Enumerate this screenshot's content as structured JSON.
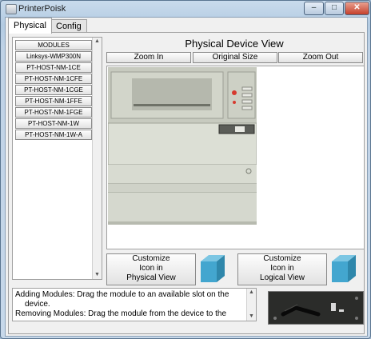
{
  "window": {
    "title": "PrinterPoisk"
  },
  "tabs": [
    {
      "label": "Physical",
      "active": true
    },
    {
      "label": "Config",
      "active": false
    }
  ],
  "modules": {
    "header": "MODULES",
    "items": [
      "Linksys-WMP300N",
      "PT-HOST-NM-1CE",
      "PT-HOST-NM-1CFE",
      "PT-HOST-NM-1CGE",
      "PT-HOST-NM-1FFE",
      "PT-HOST-NM-1FGE",
      "PT-HOST-NM-1W",
      "PT-HOST-NM-1W-A"
    ]
  },
  "view": {
    "title": "Physical Device View",
    "zoom_in": "Zoom In",
    "original_size": "Original Size",
    "zoom_out": "Zoom Out"
  },
  "customize_physical": {
    "line1": "Customize",
    "line2": "Icon in",
    "line3": "Physical View"
  },
  "customize_logical": {
    "line1": "Customize",
    "line2": "Icon in",
    "line3": "Logical View"
  },
  "info": {
    "line1": "Adding Modules: Drag the module to an available slot on the",
    "line2": "device.",
    "line3": "Removing Modules: Drag the module from the device to the"
  },
  "colors": {
    "accent_cube": "#43a6cf",
    "titlebar": "#c2d6ea"
  }
}
